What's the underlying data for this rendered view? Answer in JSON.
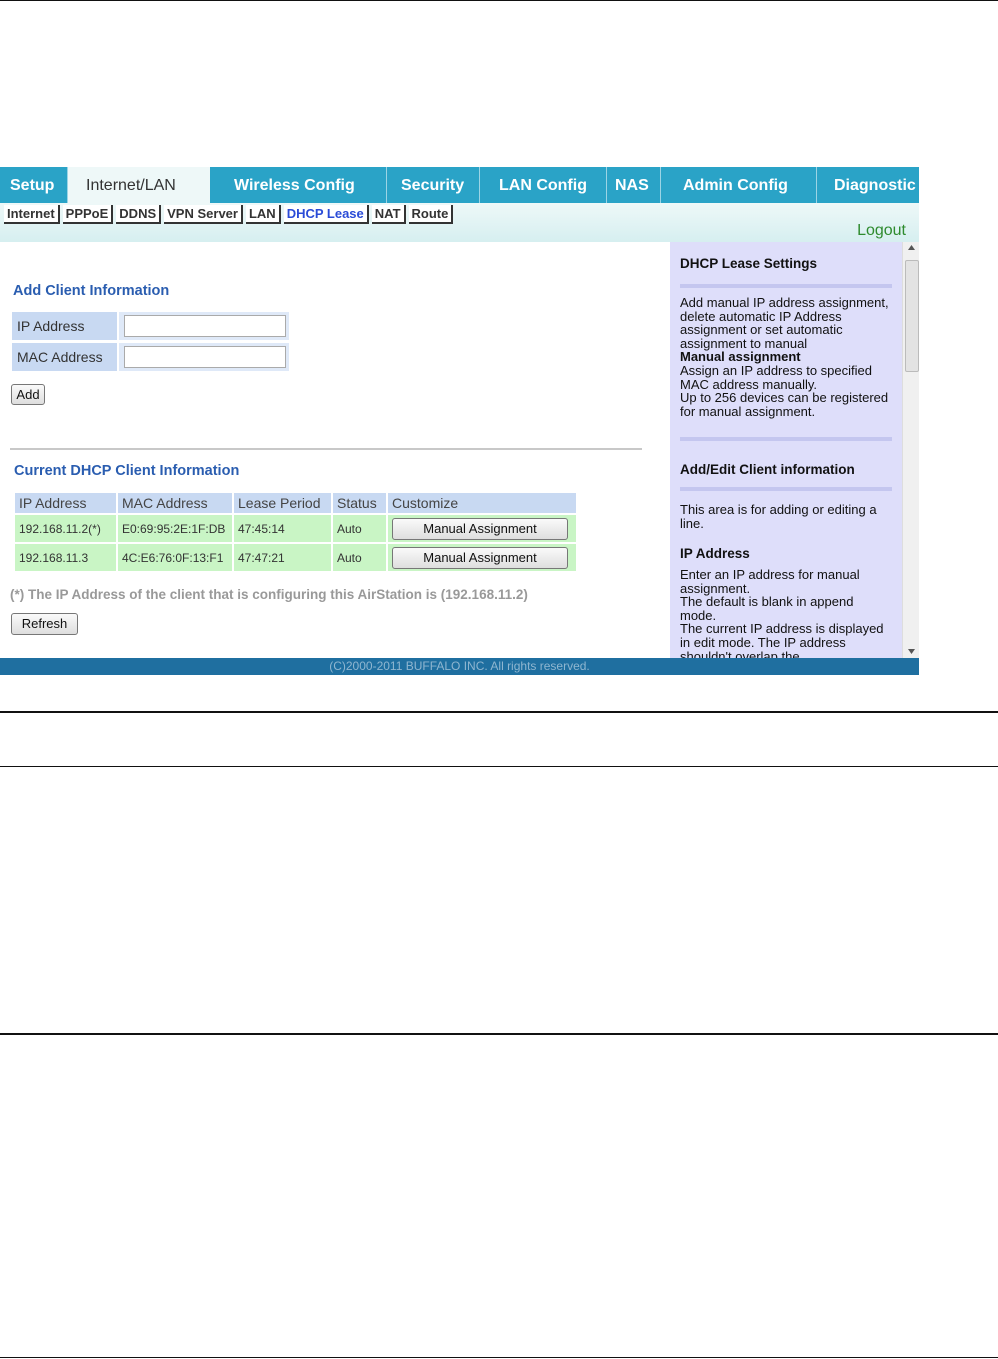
{
  "main_tabs": [
    {
      "label": "Setup",
      "active": false
    },
    {
      "label": "Internet/LAN",
      "active": true
    },
    {
      "label": "Wireless Config",
      "active": false
    },
    {
      "label": "Security",
      "active": false
    },
    {
      "label": "LAN Config",
      "active": false
    },
    {
      "label": "NAS",
      "active": false
    },
    {
      "label": "Admin Config",
      "active": false
    },
    {
      "label": "Diagnostic",
      "active": false
    }
  ],
  "sub_tabs": [
    "Internet",
    "PPPoE",
    "DDNS",
    "VPN Server",
    "LAN",
    "DHCP Lease",
    "NAT",
    "Route"
  ],
  "active_sub_tab": "DHCP Lease",
  "logout_label": "Logout",
  "add_client": {
    "title": "Add Client Information",
    "ip_label": "IP Address",
    "ip_value": "",
    "mac_label": "MAC Address",
    "mac_value": "",
    "add_button": "Add"
  },
  "current": {
    "title": "Current DHCP Client Information",
    "headers": [
      "IP Address",
      "MAC Address",
      "Lease Period",
      "Status",
      "Customize"
    ],
    "rows": [
      {
        "ip": "192.168.11.2(*)",
        "mac": "E0:69:95:2E:1F:DB",
        "lease": "47:45:14",
        "status": "Auto",
        "action": "Manual Assignment"
      },
      {
        "ip": "192.168.11.3",
        "mac": "4C:E6:76:0F:13:F1",
        "lease": "47:47:21",
        "status": "Auto",
        "action": "Manual Assignment"
      }
    ],
    "note": "(*) The IP Address of the client that is configuring this AirStation is (192.168.11.2)",
    "refresh_button": "Refresh"
  },
  "help": {
    "title": "DHCP Lease Settings",
    "intro": "Add manual IP address assignment, delete automatic IP Address assignment or set automatic assignment to manual",
    "manual_heading": "Manual assignment",
    "manual_text": "Assign an IP address to specified MAC address manually.\nUp to 256 devices can be registered for manual assignment.",
    "add_edit_title": "Add/Edit Client information",
    "add_edit_text": "This area is for adding or editing a line.",
    "ip_heading": "IP Address",
    "ip_text": "Enter an IP address for manual assignment.\nThe default is blank in append mode.\nThe current IP address is displayed in edit mode. The IP address shouldn't overlap the"
  },
  "footer": "(C)2000-2011 BUFFALO INC. All rights reserved."
}
